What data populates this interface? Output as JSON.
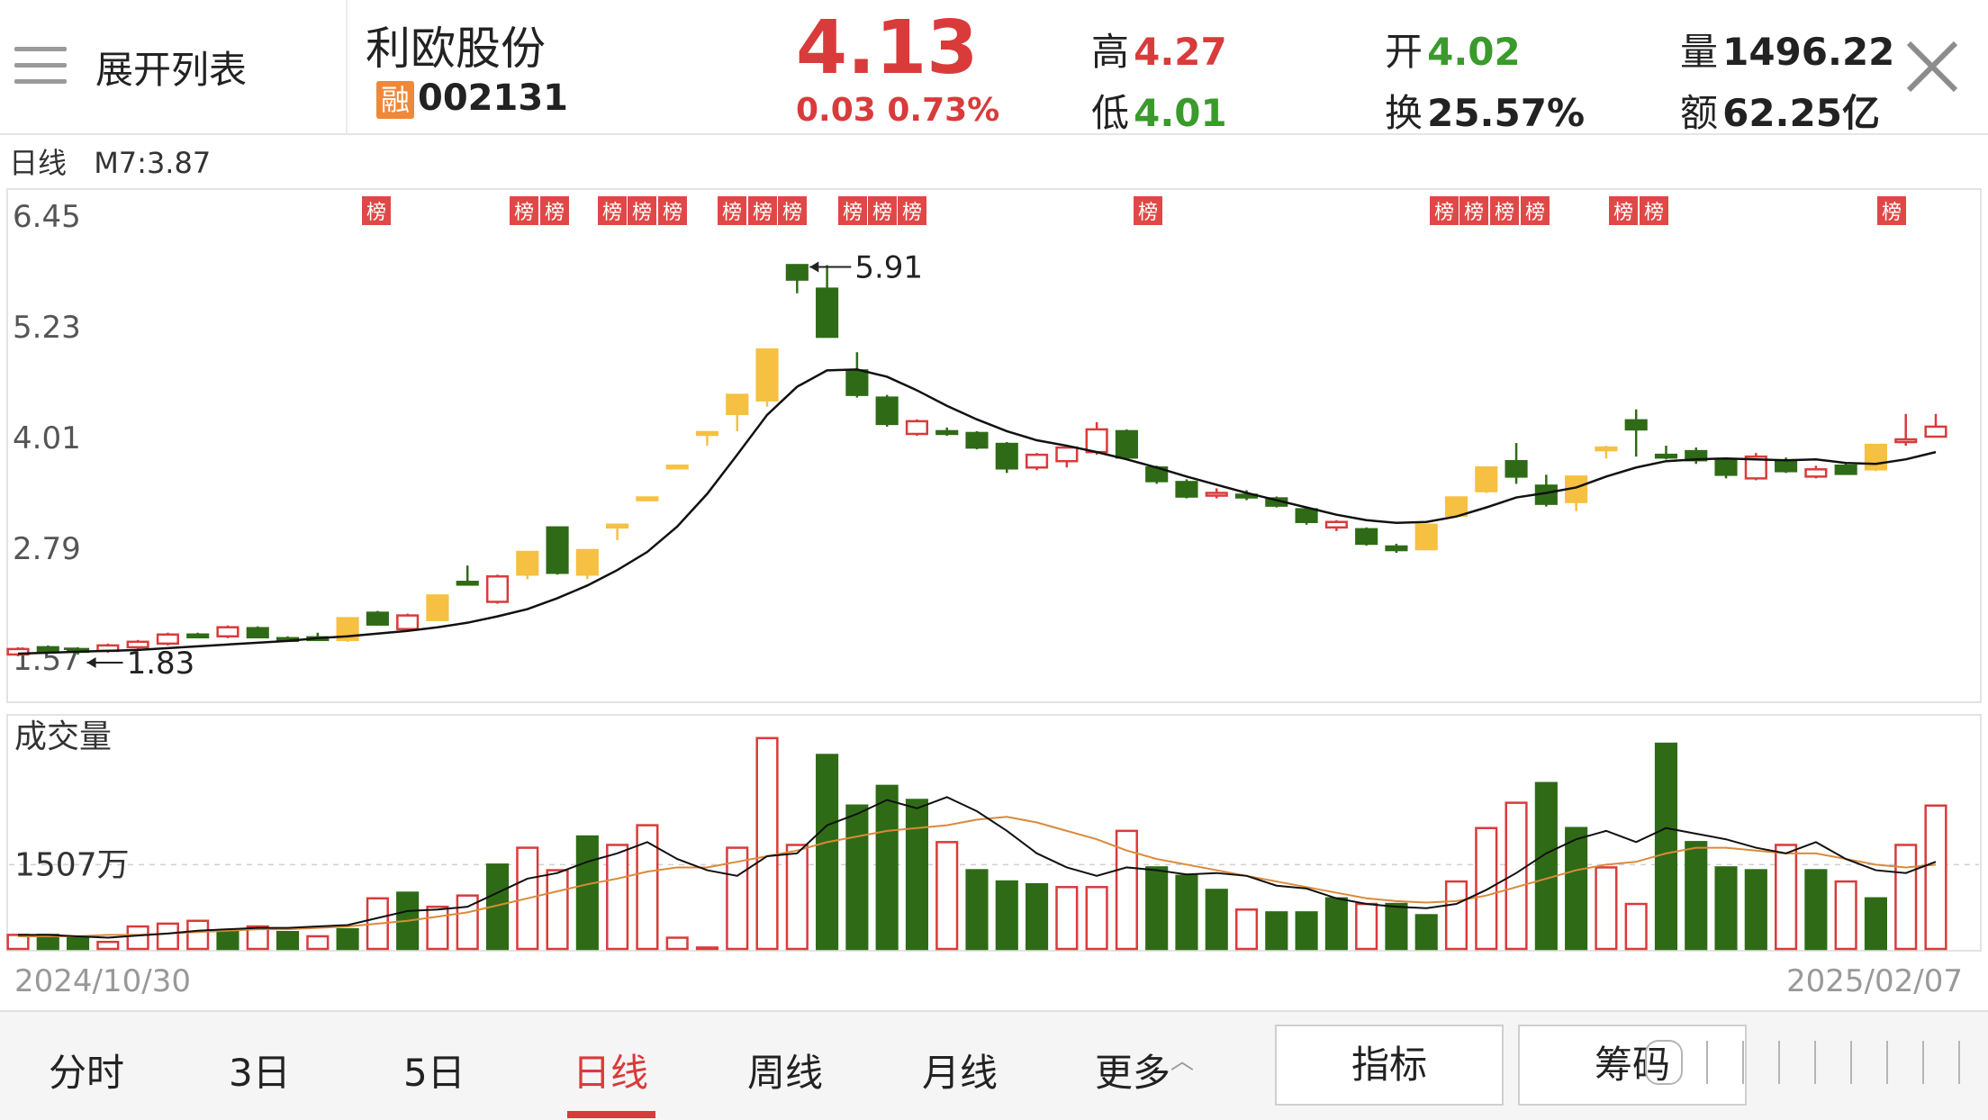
{
  "header": {
    "menu_label": "展开列表",
    "stock_name": "利欧股份",
    "badge": "融",
    "code": "002131",
    "price": "4.13",
    "change": "0.03 0.73%",
    "stats": {
      "high_label": "高",
      "high": "4.27",
      "low_label": "低",
      "low": "4.01",
      "open_label": "开",
      "open": "4.02",
      "turnover_label": "换",
      "turnover": "25.57%",
      "volume_label": "量",
      "volume": "1496.22",
      "amount_label": "额",
      "amount": "62.25亿"
    }
  },
  "chart_info": {
    "period": "日线",
    "ma": "M7:3.87"
  },
  "axis": {
    "y_labels": [
      "6.45",
      "5.23",
      "4.01",
      "2.79",
      "1.57"
    ],
    "max_label": "5.91",
    "min_label": "1.83",
    "volume_title": "成交量",
    "volume_level": "1507万",
    "start_date": "2024/10/30",
    "end_date": "2025/02/07"
  },
  "bang_label": "榜",
  "bang_groups": [
    [
      1
    ],
    [
      2,
      2
    ],
    [
      3,
      3,
      3
    ],
    [
      4,
      4,
      4
    ],
    [
      5,
      5,
      5
    ],
    [
      6
    ],
    [
      7,
      7,
      7,
      7
    ],
    [
      8,
      8
    ],
    [
      9
    ]
  ],
  "tabs": [
    "分时",
    "3日",
    "5日",
    "日线",
    "周线",
    "月线",
    "更多"
  ],
  "active_tab": "日线",
  "buttons": {
    "indicator": "指标",
    "chips": "筹码"
  },
  "colors": {
    "up": "#d93b3b",
    "down": "#2f6b16",
    "limit": "#f6c042",
    "ma": "#111111",
    "ma2": "#d98a3a"
  },
  "chart_data": {
    "type": "candlestick",
    "ylim": [
      1.57,
      6.45
    ],
    "candles": [
      {
        "o": 1.62,
        "c": 1.68,
        "h": 1.7,
        "l": 1.6,
        "t": "up"
      },
      {
        "o": 1.7,
        "c": 1.66,
        "h": 1.72,
        "l": 1.64,
        "t": "down"
      },
      {
        "o": 1.68,
        "c": 1.65,
        "h": 1.7,
        "l": 1.62,
        "t": "down"
      },
      {
        "o": 1.66,
        "c": 1.72,
        "h": 1.74,
        "l": 1.64,
        "t": "up"
      },
      {
        "o": 1.7,
        "c": 1.76,
        "h": 1.78,
        "l": 1.68,
        "t": "up"
      },
      {
        "o": 1.74,
        "c": 1.84,
        "h": 1.86,
        "l": 1.72,
        "t": "up"
      },
      {
        "o": 1.84,
        "c": 1.82,
        "h": 1.86,
        "l": 1.8,
        "t": "down"
      },
      {
        "o": 1.82,
        "c": 1.92,
        "h": 1.94,
        "l": 1.8,
        "t": "up"
      },
      {
        "o": 1.91,
        "c": 1.81,
        "h": 1.93,
        "l": 1.8,
        "t": "down"
      },
      {
        "o": 1.8,
        "c": 1.78,
        "h": 1.82,
        "l": 1.76,
        "t": "down"
      },
      {
        "o": 1.79,
        "c": 1.81,
        "h": 1.86,
        "l": 1.78,
        "t": "down"
      },
      {
        "o": 1.78,
        "c": 2.02,
        "h": 2.02,
        "l": 1.76,
        "t": "limit"
      },
      {
        "o": 2.08,
        "c": 1.95,
        "h": 2.1,
        "l": 1.94,
        "t": "down"
      },
      {
        "o": 1.9,
        "c": 2.05,
        "h": 2.07,
        "l": 1.88,
        "t": "up"
      },
      {
        "o": 2.0,
        "c": 2.27,
        "h": 2.27,
        "l": 2.0,
        "t": "limit"
      },
      {
        "o": 2.4,
        "c": 2.42,
        "h": 2.6,
        "l": 2.38,
        "t": "down"
      },
      {
        "o": 2.2,
        "c": 2.48,
        "h": 2.5,
        "l": 2.18,
        "t": "up"
      },
      {
        "o": 2.5,
        "c": 2.75,
        "h": 2.75,
        "l": 2.45,
        "t": "limit"
      },
      {
        "o": 3.02,
        "c": 2.52,
        "h": 3.02,
        "l": 2.5,
        "t": "down"
      },
      {
        "o": 2.5,
        "c": 2.77,
        "h": 2.77,
        "l": 2.45,
        "t": "limit"
      },
      {
        "o": 3.05,
        "c": 3.05,
        "h": 3.05,
        "l": 2.88,
        "t": "limit"
      },
      {
        "o": 3.35,
        "c": 3.35,
        "h": 3.35,
        "l": 3.35,
        "t": "limit"
      },
      {
        "o": 3.7,
        "c": 3.7,
        "h": 3.7,
        "l": 3.7,
        "t": "limit"
      },
      {
        "o": 4.07,
        "c": 4.07,
        "h": 4.07,
        "l": 3.92,
        "t": "limit"
      },
      {
        "o": 4.27,
        "c": 4.48,
        "h": 4.48,
        "l": 4.08,
        "t": "limit"
      },
      {
        "o": 4.42,
        "c": 4.98,
        "h": 4.98,
        "l": 4.35,
        "t": "limit"
      },
      {
        "o": 5.91,
        "c": 5.75,
        "h": 5.91,
        "l": 5.6,
        "t": "down"
      },
      {
        "o": 5.65,
        "c": 5.12,
        "h": 5.91,
        "l": 5.12,
        "t": "down"
      },
      {
        "o": 4.75,
        "c": 4.48,
        "h": 4.95,
        "l": 4.45,
        "t": "down"
      },
      {
        "o": 4.45,
        "c": 4.16,
        "h": 4.48,
        "l": 4.13,
        "t": "down"
      },
      {
        "o": 4.05,
        "c": 4.19,
        "h": 4.21,
        "l": 4.03,
        "t": "up"
      },
      {
        "o": 4.08,
        "c": 4.06,
        "h": 4.12,
        "l": 4.03,
        "t": "down"
      },
      {
        "o": 4.06,
        "c": 3.9,
        "h": 4.08,
        "l": 3.88,
        "t": "down"
      },
      {
        "o": 3.94,
        "c": 3.67,
        "h": 3.96,
        "l": 3.62,
        "t": "down"
      },
      {
        "o": 3.68,
        "c": 3.82,
        "h": 3.84,
        "l": 3.65,
        "t": "up"
      },
      {
        "o": 3.75,
        "c": 3.9,
        "h": 3.92,
        "l": 3.68,
        "t": "up"
      },
      {
        "o": 3.85,
        "c": 4.1,
        "h": 4.18,
        "l": 3.82,
        "t": "up"
      },
      {
        "o": 4.08,
        "c": 3.79,
        "h": 4.1,
        "l": 3.78,
        "t": "down"
      },
      {
        "o": 3.68,
        "c": 3.53,
        "h": 3.7,
        "l": 3.5,
        "t": "down"
      },
      {
        "o": 3.52,
        "c": 3.36,
        "h": 3.55,
        "l": 3.34,
        "t": "down"
      },
      {
        "o": 3.37,
        "c": 3.4,
        "h": 3.45,
        "l": 3.34,
        "t": "up"
      },
      {
        "o": 3.38,
        "c": 3.36,
        "h": 3.43,
        "l": 3.32,
        "t": "down"
      },
      {
        "o": 3.34,
        "c": 3.26,
        "h": 3.36,
        "l": 3.24,
        "t": "down"
      },
      {
        "o": 3.22,
        "c": 3.08,
        "h": 3.25,
        "l": 3.05,
        "t": "down"
      },
      {
        "o": 3.02,
        "c": 3.08,
        "h": 3.1,
        "l": 2.98,
        "t": "up"
      },
      {
        "o": 3.0,
        "c": 2.84,
        "h": 3.02,
        "l": 2.82,
        "t": "down"
      },
      {
        "o": 2.81,
        "c": 2.77,
        "h": 2.84,
        "l": 2.74,
        "t": "down"
      },
      {
        "o": 2.78,
        "c": 3.05,
        "h": 3.05,
        "l": 2.77,
        "t": "limit"
      },
      {
        "o": 3.15,
        "c": 3.35,
        "h": 3.35,
        "l": 3.15,
        "t": "limit"
      },
      {
        "o": 3.42,
        "c": 3.68,
        "h": 3.68,
        "l": 3.4,
        "t": "limit"
      },
      {
        "o": 3.75,
        "c": 3.58,
        "h": 3.95,
        "l": 3.5,
        "t": "down"
      },
      {
        "o": 3.48,
        "c": 3.28,
        "h": 3.6,
        "l": 3.25,
        "t": "down"
      },
      {
        "o": 3.3,
        "c": 3.58,
        "h": 3.58,
        "l": 3.2,
        "t": "limit"
      },
      {
        "o": 3.9,
        "c": 3.9,
        "h": 3.92,
        "l": 3.78,
        "t": "limit"
      },
      {
        "o": 4.2,
        "c": 4.1,
        "h": 4.32,
        "l": 3.8,
        "t": "down"
      },
      {
        "o": 3.82,
        "c": 3.8,
        "h": 3.92,
        "l": 3.77,
        "t": "down"
      },
      {
        "o": 3.86,
        "c": 3.76,
        "h": 3.9,
        "l": 3.72,
        "t": "down"
      },
      {
        "o": 3.76,
        "c": 3.6,
        "h": 3.78,
        "l": 3.56,
        "t": "down"
      },
      {
        "o": 3.56,
        "c": 3.8,
        "h": 3.84,
        "l": 3.54,
        "t": "up"
      },
      {
        "o": 3.76,
        "c": 3.64,
        "h": 3.79,
        "l": 3.62,
        "t": "down"
      },
      {
        "o": 3.58,
        "c": 3.66,
        "h": 3.7,
        "l": 3.56,
        "t": "up"
      },
      {
        "o": 3.7,
        "c": 3.61,
        "h": 3.72,
        "l": 3.6,
        "t": "down"
      },
      {
        "o": 3.66,
        "c": 3.93,
        "h": 3.93,
        "l": 3.64,
        "t": "limit"
      },
      {
        "o": 3.97,
        "c": 3.99,
        "h": 4.27,
        "l": 3.92,
        "t": "up"
      },
      {
        "o": 4.02,
        "c": 4.13,
        "h": 4.27,
        "l": 4.01,
        "t": "up"
      }
    ],
    "ma": [
      1.63,
      1.64,
      1.65,
      1.66,
      1.67,
      1.69,
      1.71,
      1.73,
      1.75,
      1.77,
      1.8,
      1.82,
      1.85,
      1.88,
      1.92,
      1.97,
      2.04,
      2.12,
      2.24,
      2.38,
      2.55,
      2.75,
      3.03,
      3.39,
      3.82,
      4.26,
      4.57,
      4.75,
      4.76,
      4.68,
      4.53,
      4.36,
      4.21,
      4.08,
      3.98,
      3.92,
      3.85,
      3.77,
      3.68,
      3.58,
      3.49,
      3.4,
      3.32,
      3.24,
      3.16,
      3.1,
      3.07,
      3.08,
      3.14,
      3.24,
      3.35,
      3.4,
      3.46,
      3.58,
      3.68,
      3.75,
      3.77,
      3.78,
      3.77,
      3.76,
      3.77,
      3.73,
      3.72,
      3.77,
      3.85
    ],
    "volumes": [
      {
        "v": 1.0,
        "t": "up"
      },
      {
        "v": 1.0,
        "t": "down"
      },
      {
        "v": 0.8,
        "t": "down"
      },
      {
        "v": 0.5,
        "t": "up"
      },
      {
        "v": 1.6,
        "t": "up"
      },
      {
        "v": 1.8,
        "t": "up"
      },
      {
        "v": 2.0,
        "t": "up"
      },
      {
        "v": 1.2,
        "t": "down"
      },
      {
        "v": 1.6,
        "t": "up"
      },
      {
        "v": 1.2,
        "t": "down"
      },
      {
        "v": 0.9,
        "t": "up"
      },
      {
        "v": 1.4,
        "t": "down"
      },
      {
        "v": 3.6,
        "t": "up"
      },
      {
        "v": 4.0,
        "t": "down"
      },
      {
        "v": 3.0,
        "t": "up"
      },
      {
        "v": 3.8,
        "t": "up"
      },
      {
        "v": 6.0,
        "t": "down"
      },
      {
        "v": 7.2,
        "t": "up"
      },
      {
        "v": 5.6,
        "t": "up"
      },
      {
        "v": 8.0,
        "t": "down"
      },
      {
        "v": 7.4,
        "t": "up"
      },
      {
        "v": 8.8,
        "t": "up"
      },
      {
        "v": 0.8,
        "t": "up"
      },
      {
        "v": 0.1,
        "t": "up"
      },
      {
        "v": 7.2,
        "t": "up"
      },
      {
        "v": 15.0,
        "t": "up"
      },
      {
        "v": 7.4,
        "t": "up"
      },
      {
        "v": 13.8,
        "t": "down"
      },
      {
        "v": 10.2,
        "t": "down"
      },
      {
        "v": 11.6,
        "t": "down"
      },
      {
        "v": 10.6,
        "t": "down"
      },
      {
        "v": 7.6,
        "t": "up"
      },
      {
        "v": 5.6,
        "t": "down"
      },
      {
        "v": 4.8,
        "t": "down"
      },
      {
        "v": 4.6,
        "t": "down"
      },
      {
        "v": 4.4,
        "t": "up"
      },
      {
        "v": 4.4,
        "t": "up"
      },
      {
        "v": 8.4,
        "t": "up"
      },
      {
        "v": 5.8,
        "t": "down"
      },
      {
        "v": 5.2,
        "t": "down"
      },
      {
        "v": 4.2,
        "t": "down"
      },
      {
        "v": 2.8,
        "t": "up"
      },
      {
        "v": 2.6,
        "t": "down"
      },
      {
        "v": 2.6,
        "t": "down"
      },
      {
        "v": 3.6,
        "t": "down"
      },
      {
        "v": 3.2,
        "t": "up"
      },
      {
        "v": 3.2,
        "t": "down"
      },
      {
        "v": 2.4,
        "t": "down"
      },
      {
        "v": 4.8,
        "t": "up"
      },
      {
        "v": 8.6,
        "t": "up"
      },
      {
        "v": 10.4,
        "t": "up"
      },
      {
        "v": 11.8,
        "t": "down"
      },
      {
        "v": 8.6,
        "t": "down"
      },
      {
        "v": 5.8,
        "t": "up"
      },
      {
        "v": 3.2,
        "t": "up"
      },
      {
        "v": 14.6,
        "t": "down"
      },
      {
        "v": 7.6,
        "t": "down"
      },
      {
        "v": 5.8,
        "t": "down"
      },
      {
        "v": 5.6,
        "t": "down"
      },
      {
        "v": 7.4,
        "t": "up"
      },
      {
        "v": 5.6,
        "t": "down"
      },
      {
        "v": 4.8,
        "t": "up"
      },
      {
        "v": 3.6,
        "t": "down"
      },
      {
        "v": 7.4,
        "t": "up"
      },
      {
        "v": 10.2,
        "t": "up"
      },
      {
        "v": 8.4,
        "t": "up"
      }
    ],
    "vol_ma": [
      1.0,
      1.0,
      0.9,
      0.8,
      0.95,
      1.1,
      1.3,
      1.4,
      1.5,
      1.5,
      1.6,
      1.7,
      2.2,
      2.7,
      2.8,
      3.0,
      4.0,
      5.0,
      5.4,
      6.2,
      6.8,
      7.6,
      6.4,
      5.6,
      5.2,
      6.6,
      6.8,
      8.8,
      9.6,
      10.6,
      10.0,
      10.8,
      9.8,
      8.4,
      6.8,
      5.8,
      5.2,
      5.8,
      5.6,
      5.3,
      5.4,
      5.2,
      4.5,
      4.3,
      3.6,
      3.2,
      3.0,
      2.9,
      3.2,
      4.2,
      5.4,
      6.8,
      7.8,
      8.4,
      7.6,
      8.6,
      8.2,
      7.8,
      7.2,
      6.8,
      7.6,
      6.4,
      5.6,
      5.4,
      6.2,
      7.0,
      7.2
    ],
    "vol_ma2": [
      0.9,
      0.9,
      0.9,
      1.0,
      1.0,
      1.1,
      1.2,
      1.3,
      1.4,
      1.4,
      1.5,
      1.6,
      1.8,
      2.0,
      2.3,
      2.6,
      3.1,
      3.6,
      4.1,
      4.6,
      5.0,
      5.5,
      5.8,
      5.8,
      6.2,
      6.6,
      7.0,
      7.6,
      8.0,
      8.4,
      8.6,
      8.8,
      9.2,
      9.4,
      9.0,
      8.4,
      7.8,
      7.0,
      6.4,
      6.0,
      5.6,
      5.2,
      4.8,
      4.4,
      4.0,
      3.6,
      3.4,
      3.3,
      3.4,
      3.8,
      4.4,
      5.0,
      5.6,
      6.0,
      6.2,
      6.8,
      7.2,
      7.2,
      7.0,
      6.8,
      6.8,
      6.4,
      6.0,
      5.8,
      6.0,
      6.4,
      6.6
    ]
  }
}
